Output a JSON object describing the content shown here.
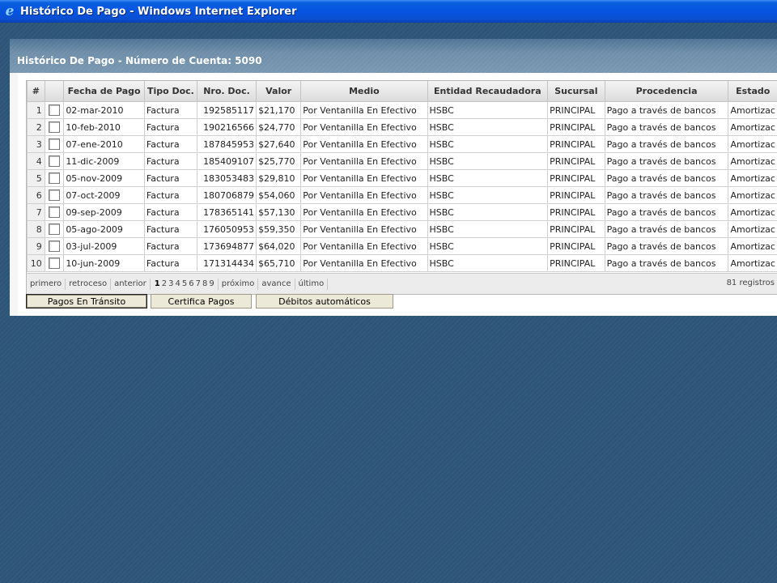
{
  "window": {
    "title": "Histórico De Pago - Windows Internet Explorer",
    "icon": "ie-logo-icon"
  },
  "page": {
    "title": "Histórico De Pago - Número de Cuenta: 5090"
  },
  "grid": {
    "columns": [
      "#",
      "",
      "Fecha de Pago",
      "Tipo Doc.",
      "Nro. Doc.",
      "Valor",
      "Medio",
      "Entidad Recaudadora",
      "Sucursal",
      "Procedencia",
      "Estado"
    ],
    "rows": [
      {
        "n": "1",
        "fecha": "02-mar-2010",
        "tipo": "Factura",
        "nro": "192585117",
        "valor": "$21,170",
        "medio": "Por Ventanilla En Efectivo",
        "entidad": "HSBC",
        "sucursal": "PRINCIPAL",
        "procedencia": "Pago a través de bancos",
        "estado": "Amortizac"
      },
      {
        "n": "2",
        "fecha": "10-feb-2010",
        "tipo": "Factura",
        "nro": "190216566",
        "valor": "$24,770",
        "medio": "Por Ventanilla En Efectivo",
        "entidad": "HSBC",
        "sucursal": "PRINCIPAL",
        "procedencia": "Pago a través de bancos",
        "estado": "Amortizac"
      },
      {
        "n": "3",
        "fecha": "07-ene-2010",
        "tipo": "Factura",
        "nro": "187845953",
        "valor": "$27,640",
        "medio": "Por Ventanilla En Efectivo",
        "entidad": "HSBC",
        "sucursal": "PRINCIPAL",
        "procedencia": "Pago a través de bancos",
        "estado": "Amortizac"
      },
      {
        "n": "4",
        "fecha": "11-dic-2009",
        "tipo": "Factura",
        "nro": "185409107",
        "valor": "$25,770",
        "medio": "Por Ventanilla En Efectivo",
        "entidad": "HSBC",
        "sucursal": "PRINCIPAL",
        "procedencia": "Pago a través de bancos",
        "estado": "Amortizac"
      },
      {
        "n": "5",
        "fecha": "05-nov-2009",
        "tipo": "Factura",
        "nro": "183053483",
        "valor": "$29,810",
        "medio": "Por Ventanilla En Efectivo",
        "entidad": "HSBC",
        "sucursal": "PRINCIPAL",
        "procedencia": "Pago a través de bancos",
        "estado": "Amortizac"
      },
      {
        "n": "6",
        "fecha": "07-oct-2009",
        "tipo": "Factura",
        "nro": "180706879",
        "valor": "$54,060",
        "medio": "Por Ventanilla En Efectivo",
        "entidad": "HSBC",
        "sucursal": "PRINCIPAL",
        "procedencia": "Pago a través de bancos",
        "estado": "Amortizac"
      },
      {
        "n": "7",
        "fecha": "09-sep-2009",
        "tipo": "Factura",
        "nro": "178365141",
        "valor": "$57,130",
        "medio": "Por Ventanilla En Efectivo",
        "entidad": "HSBC",
        "sucursal": "PRINCIPAL",
        "procedencia": "Pago a través de bancos",
        "estado": "Amortizac"
      },
      {
        "n": "8",
        "fecha": "05-ago-2009",
        "tipo": "Factura",
        "nro": "176050953",
        "valor": "$59,350",
        "medio": "Por Ventanilla En Efectivo",
        "entidad": "HSBC",
        "sucursal": "PRINCIPAL",
        "procedencia": "Pago a través de bancos",
        "estado": "Amortizac"
      },
      {
        "n": "9",
        "fecha": "03-jul-2009",
        "tipo": "Factura",
        "nro": "173694877",
        "valor": "$64,020",
        "medio": "Por Ventanilla En Efectivo",
        "entidad": "HSBC",
        "sucursal": "PRINCIPAL",
        "procedencia": "Pago a través de bancos",
        "estado": "Amortizac"
      },
      {
        "n": "10",
        "fecha": "10-jun-2009",
        "tipo": "Factura",
        "nro": "171314434",
        "valor": "$65,710",
        "medio": "Por Ventanilla En Efectivo",
        "entidad": "HSBC",
        "sucursal": "PRINCIPAL",
        "procedencia": "Pago a través de bancos",
        "estado": "Amortizac"
      }
    ]
  },
  "pager": {
    "first": "primero",
    "rewind": "retroceso",
    "previous": "anterior",
    "pages": [
      "1",
      "2",
      "3",
      "4",
      "5",
      "6",
      "7",
      "8",
      "9"
    ],
    "current_page": "1",
    "next": "próximo",
    "forward": "avance",
    "last": "último",
    "records": "81 registros"
  },
  "buttons": {
    "transit": "Pagos En Tránsito",
    "certify": "Certifica Pagos",
    "debits": "Débitos automáticos"
  }
}
